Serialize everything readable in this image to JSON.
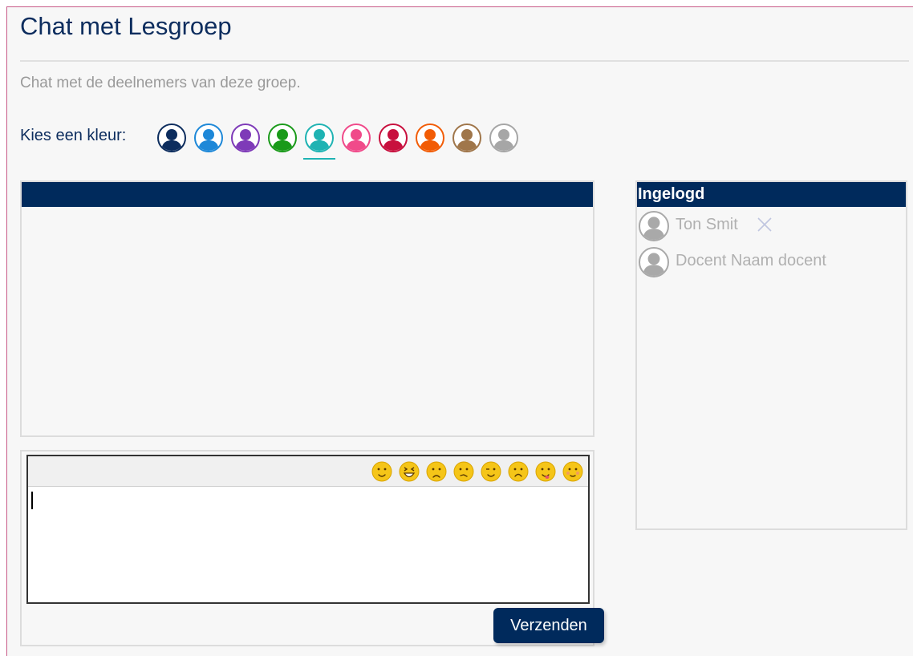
{
  "page": {
    "title": "Chat met Lesgroep",
    "subtitle": "Chat met de deelnemers van deze groep."
  },
  "color_picker": {
    "label": "Kies een kleur:",
    "selected": "teal",
    "colors": [
      {
        "name": "navy",
        "hex": "#0d2d5e"
      },
      {
        "name": "blue",
        "hex": "#1e88d8"
      },
      {
        "name": "purple",
        "hex": "#7e3ab8"
      },
      {
        "name": "green",
        "hex": "#1a9a1a"
      },
      {
        "name": "teal",
        "hex": "#1fb3b3"
      },
      {
        "name": "pink",
        "hex": "#f04a8a"
      },
      {
        "name": "crimson",
        "hex": "#c8103e"
      },
      {
        "name": "orange",
        "hex": "#f25c05"
      },
      {
        "name": "brown",
        "hex": "#a0764a"
      },
      {
        "name": "gray",
        "hex": "#a6a6a6"
      }
    ]
  },
  "chat": {
    "header_color": "#002a5c",
    "messages": []
  },
  "composer": {
    "emojis": [
      "smile-emoji-icon",
      "laugh-emoji-icon",
      "sad-emoji-icon",
      "confused-emoji-icon",
      "wink-emoji-icon",
      "surprised-emoji-icon",
      "tongue-emoji-icon",
      "blush-emoji-icon"
    ],
    "value": "",
    "send_label": "Verzenden"
  },
  "online": {
    "header": "Ingelogd",
    "users": [
      {
        "name": "Ton Smit",
        "removable": true
      },
      {
        "name": "Docent Naam docent",
        "removable": false
      }
    ]
  },
  "colors": {
    "accent": "#002a5c",
    "title": "#0d2d5e",
    "muted_text": "#9a9a9a",
    "emoji_yellow": "#f5c518"
  }
}
